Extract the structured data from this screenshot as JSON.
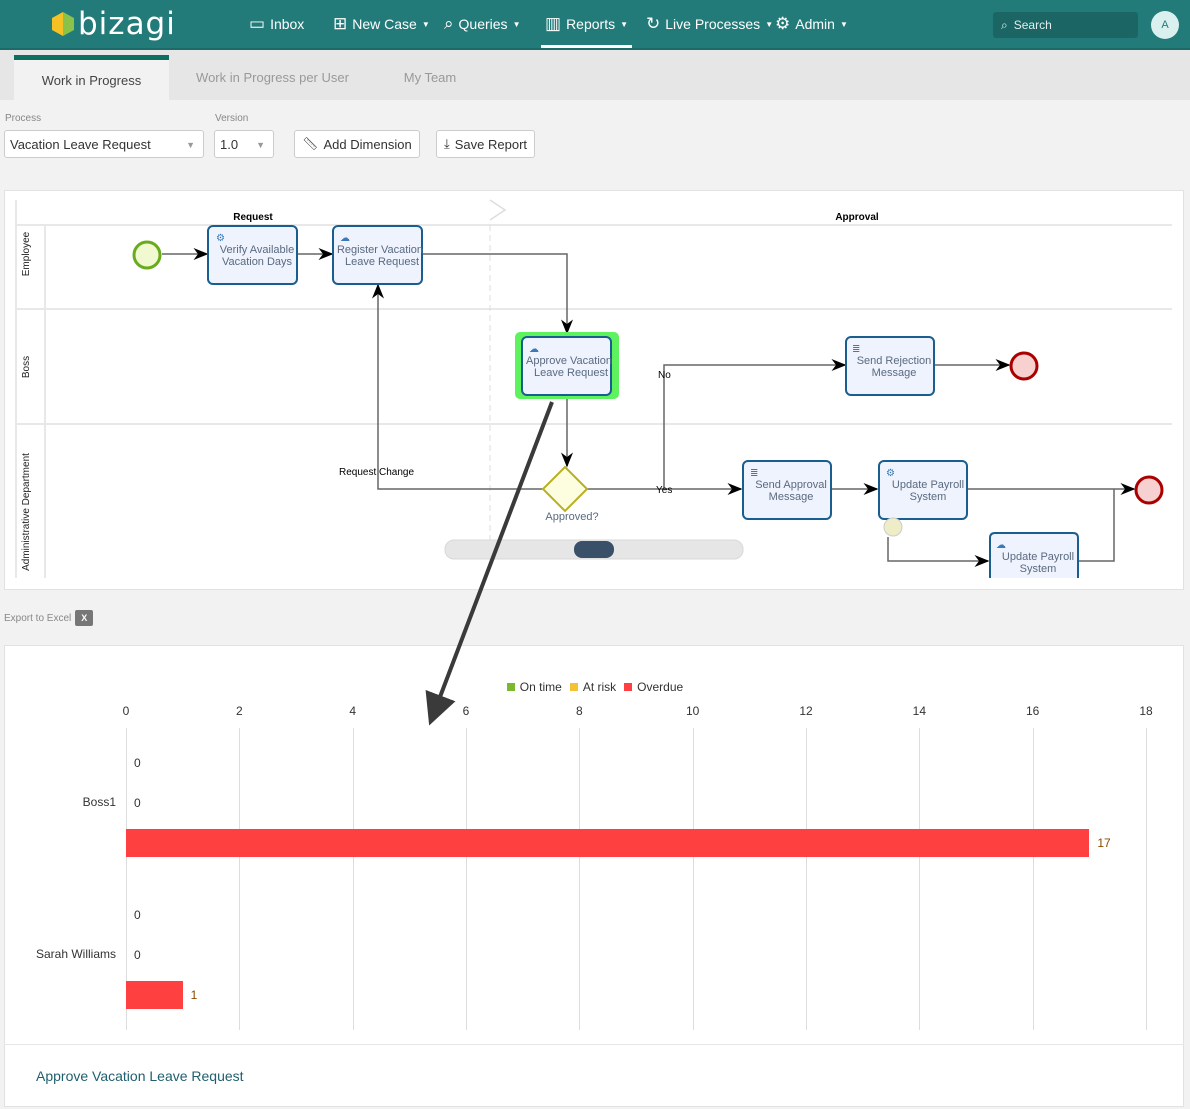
{
  "nav": {
    "brand": "bizagi",
    "items": [
      {
        "label": "Inbox",
        "icon": "inbox-icon"
      },
      {
        "label": "New Case",
        "icon": "new-case-icon"
      },
      {
        "label": "Queries",
        "icon": "search-icon"
      },
      {
        "label": "Reports",
        "icon": "chart-icon"
      },
      {
        "label": "Live Processes",
        "icon": "lightning-icon"
      },
      {
        "label": "Admin",
        "icon": "gear-icon"
      }
    ],
    "search_placeholder": "Search",
    "avatar": "A",
    "color": "#227b79"
  },
  "tabs": [
    {
      "label": "Work in Progress",
      "active": true
    },
    {
      "label": "Work in Progress per User",
      "active": false
    },
    {
      "label": "My Team",
      "active": false
    }
  ],
  "filters": {
    "process_label": "Process",
    "process_value": "Vacation Leave Request",
    "version_label": "Version",
    "version_value": "1.0",
    "add_dimension": "Add Dimension",
    "save_report": "Save Report"
  },
  "diagram": {
    "phases": [
      "Request",
      "Approval"
    ],
    "lanes": [
      "Employee",
      "Boss",
      "Administrative Department"
    ],
    "tasks": {
      "verify": [
        "Verify Available",
        "Vacation Days"
      ],
      "register": [
        "Register Vacation",
        "Leave Request"
      ],
      "approve": [
        "Approve Vacation",
        "Leave Request"
      ],
      "rejection": [
        "Send Rejection",
        "Message"
      ],
      "approval_msg": [
        "Send Approval",
        "Message"
      ],
      "payroll1": [
        "Update Payroll",
        "System"
      ],
      "payroll2": [
        "Update Payroll",
        "System"
      ]
    },
    "gateway": "Approved?",
    "flow_labels": {
      "no": "No",
      "yes": "Yes",
      "change": "Request Change"
    },
    "highlight_color": "#5ef35e"
  },
  "export_label": "Export to Excel",
  "chart_data": {
    "type": "bar",
    "orientation": "horizontal",
    "categories": [
      "Boss1",
      "Sarah Williams"
    ],
    "series": [
      {
        "name": "On time",
        "color": "#7cb82f",
        "values": [
          0,
          0
        ]
      },
      {
        "name": "At risk",
        "color": "#f5c232",
        "values": [
          0,
          0
        ]
      },
      {
        "name": "Overdue",
        "color": "#ff4040",
        "values": [
          17,
          1
        ]
      }
    ],
    "xlim": [
      0,
      18
    ],
    "ticks": [
      "0",
      "2",
      "4",
      "6",
      "8",
      "10",
      "12",
      "14",
      "16",
      "18"
    ],
    "axis_position": "top",
    "legend_position": "top",
    "grid": true
  },
  "footer_title": "Approve Vacation Leave Request"
}
